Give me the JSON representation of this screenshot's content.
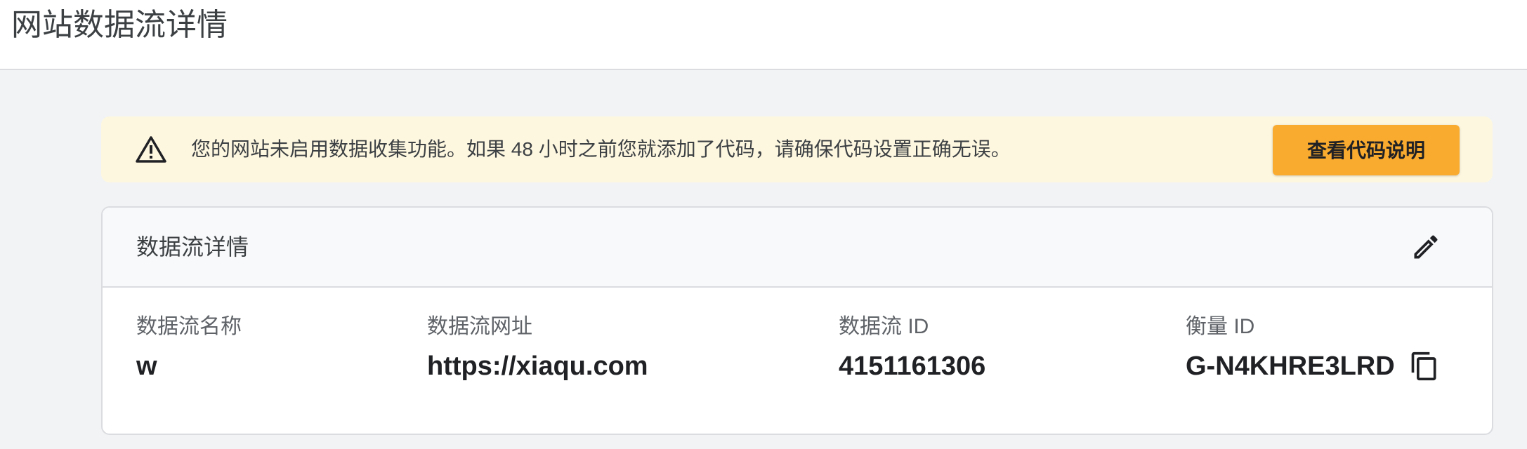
{
  "header": {
    "title": "网站数据流详情"
  },
  "alert": {
    "icon": "warning-icon",
    "message": "您的网站未启用数据收集功能。如果 48 小时之前您就添加了代码，请确保代码设置正确无误。",
    "button_label": "查看代码说明",
    "background_color": "#fef7e0",
    "button_color": "#f9ab2f"
  },
  "details": {
    "title": "数据流详情",
    "edit_icon": "pencil-icon",
    "fields": {
      "stream_name": {
        "label": "数据流名称",
        "value": "w"
      },
      "stream_url": {
        "label": "数据流网址",
        "value": "https://xiaqu.com"
      },
      "stream_id": {
        "label": "数据流 ID",
        "value": "4151161306"
      },
      "measurement_id": {
        "label": "衡量 ID",
        "value": "G-N4KHRE3LRD"
      }
    },
    "copy_icon": "copy-icon"
  }
}
